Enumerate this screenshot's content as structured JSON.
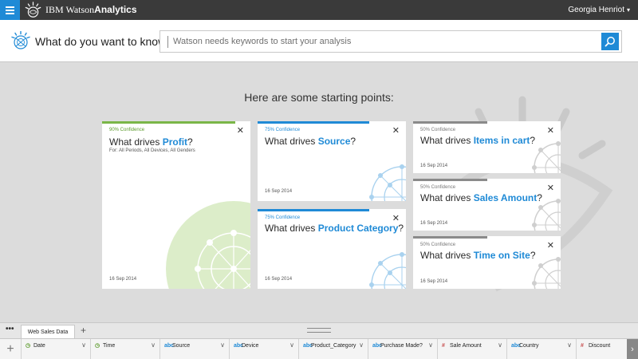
{
  "topbar": {
    "brand_light": "IBM Watson",
    "brand_bold": "Analytics",
    "user_name": "Georgia Henriot",
    "user_caret": "▾"
  },
  "ask": {
    "label": "What do you want to know?",
    "placeholder": "Watson needs keywords to start your analysis"
  },
  "main": {
    "heading": "Here are some starting points:"
  },
  "cards": [
    {
      "confidence": "90% Confidence",
      "prefix": "What drives ",
      "keyword": "Profit",
      "suffix": "?",
      "subtitle": "For:  All Periods, All Devices, All Genders",
      "date": "16 Sep 2014",
      "bar_color": "#7ab648",
      "conf_color": "#5a9a2a",
      "confidence_pct": 90
    },
    {
      "confidence": "75% Confidence",
      "prefix": "What drives ",
      "keyword": "Source",
      "suffix": "?",
      "date": "16 Sep 2014",
      "bar_color": "#1f8ad6",
      "conf_color": "#1f8ad6",
      "confidence_pct": 75
    },
    {
      "confidence": "75% Confidence",
      "prefix": "What drives ",
      "keyword": "Product Category",
      "suffix": "?",
      "date": "16 Sep 2014",
      "bar_color": "#1f8ad6",
      "conf_color": "#1f8ad6",
      "confidence_pct": 75
    },
    {
      "confidence": "50% Confidence",
      "prefix": "What drives ",
      "keyword": "Items in cart",
      "suffix": "?",
      "date": "16 Sep 2014",
      "bar_color": "#8a8a8a",
      "conf_color": "#777777",
      "confidence_pct": 50
    },
    {
      "confidence": "50% Confidence",
      "prefix": "What drives ",
      "keyword": "Sales Amount",
      "suffix": "?",
      "date": "16 Sep 2014",
      "bar_color": "#8a8a8a",
      "conf_color": "#777777",
      "confidence_pct": 50
    },
    {
      "confidence": "50% Confidence",
      "prefix": "What drives ",
      "keyword": "Time on Site",
      "suffix": "?",
      "date": "16 Sep 2014",
      "bar_color": "#8a8a8a",
      "conf_color": "#777777",
      "confidence_pct": 50
    }
  ],
  "card_close_glyph": "✕",
  "tabs": {
    "more": "•••",
    "active_tab": "Web Sales Data",
    "add": "+"
  },
  "columns": {
    "add": "+",
    "chevron": "∨",
    "scroll": "›",
    "items": [
      {
        "type_icon": "clock-icon",
        "type_glyph": "◷",
        "name": "Date"
      },
      {
        "type_icon": "clock-icon",
        "type_glyph": "◷",
        "name": "Time"
      },
      {
        "type_icon": "abc-icon",
        "type_glyph": "abc",
        "name": "Source"
      },
      {
        "type_icon": "abc-icon",
        "type_glyph": "abc",
        "name": "Device"
      },
      {
        "type_icon": "abc-icon",
        "type_glyph": "abc",
        "name": "Product_Category"
      },
      {
        "type_icon": "abc-icon",
        "type_glyph": "abc",
        "name": "Purchase Made?"
      },
      {
        "type_icon": "hash-icon",
        "type_glyph": "#",
        "name": "Sale Amount"
      },
      {
        "type_icon": "abc-icon",
        "type_glyph": "abc",
        "name": "Country"
      },
      {
        "type_icon": "hash-icon",
        "type_glyph": "#",
        "name": "Discount"
      }
    ]
  },
  "colors": {
    "accent_blue": "#1f8ad6",
    "topbar": "#3a3a3a",
    "background": "#dcdcdc",
    "green": "#7ab648"
  }
}
